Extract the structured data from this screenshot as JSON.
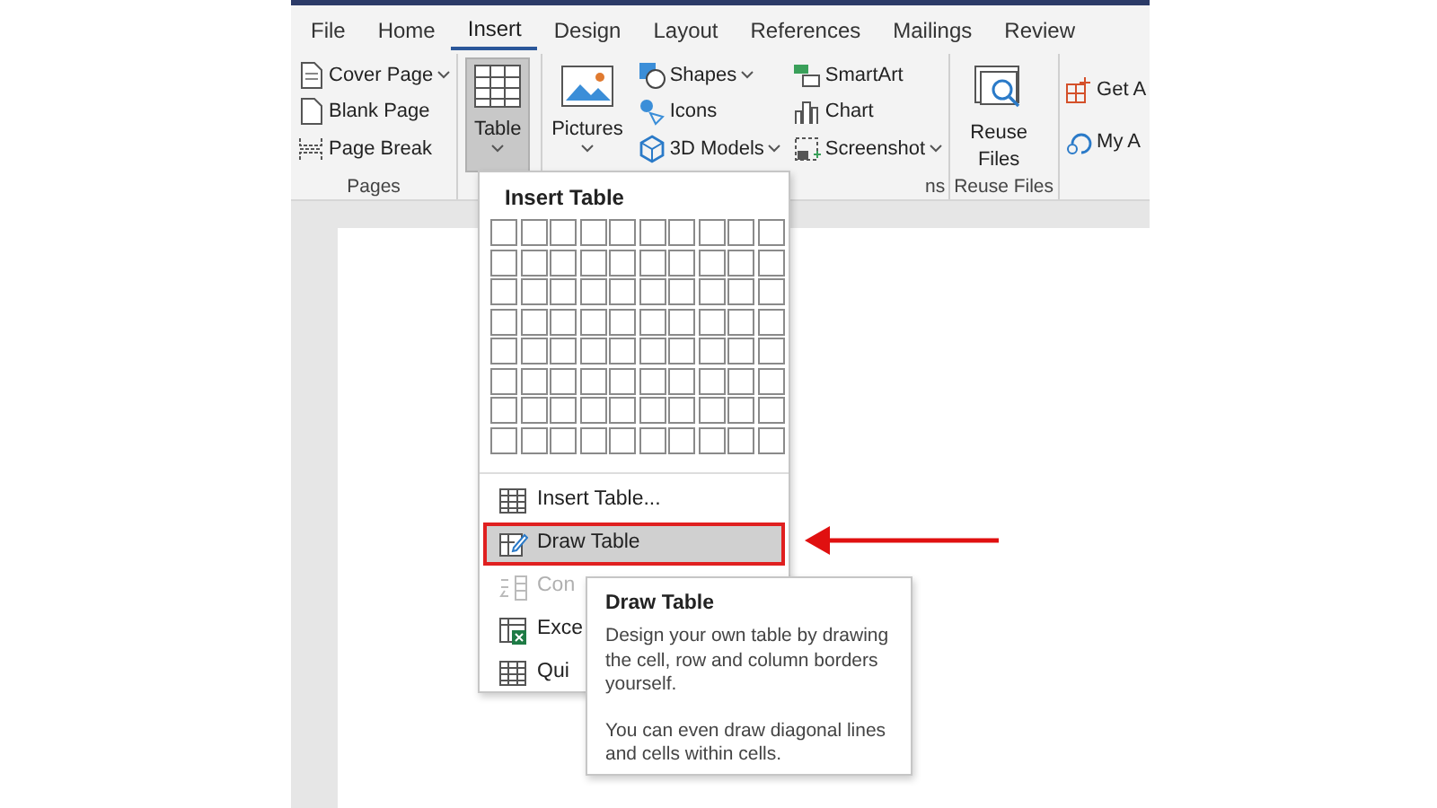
{
  "tabs": [
    {
      "label": "File",
      "selected": false
    },
    {
      "label": "Home",
      "selected": false
    },
    {
      "label": "Insert",
      "selected": true
    },
    {
      "label": "Design",
      "selected": false
    },
    {
      "label": "Layout",
      "selected": false
    },
    {
      "label": "References",
      "selected": false
    },
    {
      "label": "Mailings",
      "selected": false
    },
    {
      "label": "Review",
      "selected": false
    }
  ],
  "ribbon_groups": [
    {
      "label": "Pages",
      "items": [
        {
          "kind": "small",
          "label": "Cover Page",
          "dropdown": true,
          "pressed": false
        },
        {
          "kind": "small",
          "label": "Blank Page",
          "dropdown": false,
          "pressed": false
        },
        {
          "kind": "small",
          "label": "Page Break",
          "dropdown": false,
          "pressed": false
        }
      ]
    },
    {
      "items": [
        {
          "kind": "large",
          "label": "Table",
          "dropdown": true,
          "pressed": true
        }
      ]
    },
    {
      "label": "ns",
      "items": [
        {
          "kind": "large",
          "label": "Pictures",
          "dropdown": true,
          "pressed": false
        },
        {
          "kind": "small",
          "label": "Shapes",
          "dropdown": true,
          "pressed": false
        },
        {
          "kind": "small",
          "label": "Icons",
          "dropdown": false,
          "pressed": false
        },
        {
          "kind": "small",
          "label": "3D Models",
          "dropdown": true,
          "pressed": false
        },
        {
          "kind": "small",
          "label": "SmartArt",
          "dropdown": false,
          "pressed": false
        },
        {
          "kind": "small",
          "label": "Chart",
          "dropdown": false,
          "pressed": false
        },
        {
          "kind": "small",
          "label": "Screenshot",
          "dropdown": true,
          "pressed": false
        }
      ]
    },
    {
      "label": "Reuse Files",
      "items": [
        {
          "kind": "large",
          "label": "Reuse Files",
          "dropdown": false,
          "pressed": false
        }
      ]
    },
    {
      "items": [
        {
          "kind": "small",
          "label": "Get A",
          "dropdown": false,
          "pressed": false
        },
        {
          "kind": "small",
          "label": "My A",
          "dropdown": false,
          "pressed": false
        }
      ]
    }
  ],
  "menu": {
    "title": "Insert Table",
    "items": [
      {
        "label": "Insert Table...",
        "selected": false,
        "disabled": false,
        "marked": false
      },
      {
        "label": "Draw Table",
        "selected": true,
        "disabled": false,
        "marked": true
      },
      {
        "label": "Con",
        "selected": false,
        "disabled": true,
        "marked": false
      },
      {
        "label": "Exce",
        "selected": false,
        "disabled": false,
        "marked": false
      },
      {
        "label": "Qui",
        "selected": false,
        "disabled": false,
        "marked": false
      }
    ]
  },
  "tooltip": {
    "title": "Draw Table",
    "paragraphs": [
      "Design your own table by drawing the cell, row and column borders yourself.",
      "You can even draw diagonal lines and cells within cells."
    ]
  }
}
